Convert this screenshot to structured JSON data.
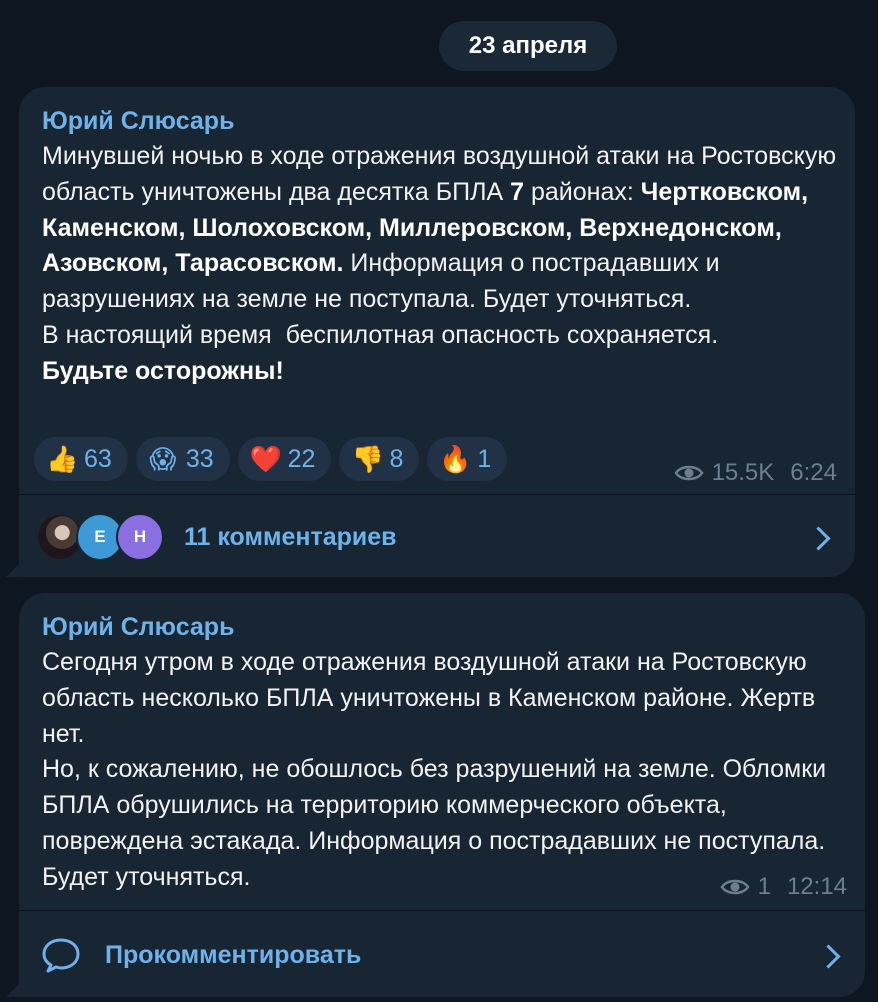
{
  "date_label": "23 апреля",
  "messages": [
    {
      "author": "Юрий Слюсарь",
      "text_html": "Минувшей ночью в ходе отражения воздушной атаки на Ростовскую область уничтожены два десятка БПЛА <b>7</b> районах: <b>Чертковском, Каменском, Шолоховском, Миллеровском, Верхнедонском, Азовском, Тарасовском.</b> Информация о пострадавших и разрушениях на земле не поступала. Будет уточняться.\nВ настоящий время  беспилотная опасность сохраняется.\n<b>Будьте осторожны!</b>",
      "reactions": [
        {
          "emoji": "👍",
          "count": "63"
        },
        {
          "emoji": "😱",
          "count": "33"
        },
        {
          "emoji": "❤️",
          "count": "22"
        },
        {
          "emoji": "👎",
          "count": "8"
        },
        {
          "emoji": "🔥",
          "count": "1"
        }
      ],
      "views": "15.5K",
      "time": "6:24",
      "avatars": [
        "",
        "E",
        "H"
      ],
      "comments_label": "11 комментариев"
    },
    {
      "author": "Юрий Слюсарь",
      "text_html": "Сегодня утром в ходе отражения воздушной атаки на Ростовскую область несколько БПЛА уничтожены в Каменском районе. Жертв нет.\nНо, к сожалению, не обошлось без разрушений на земле. Обломки  БПЛА обрушились на территорию коммерческого объекта, повреждена эстакада. Информация о пострадавших не поступала. Будет уточняться.",
      "views": "1",
      "time": "12:14",
      "comments_label": "Прокомментировать"
    }
  ],
  "icons": {
    "views": "eye-icon",
    "comment": "speech-bubble-icon",
    "chevron": "chevron-right-icon"
  },
  "colors": {
    "background": "#0e1621",
    "bubble": "#182533",
    "accent": "#6fb2ea",
    "meta": "#6d7f8f"
  }
}
